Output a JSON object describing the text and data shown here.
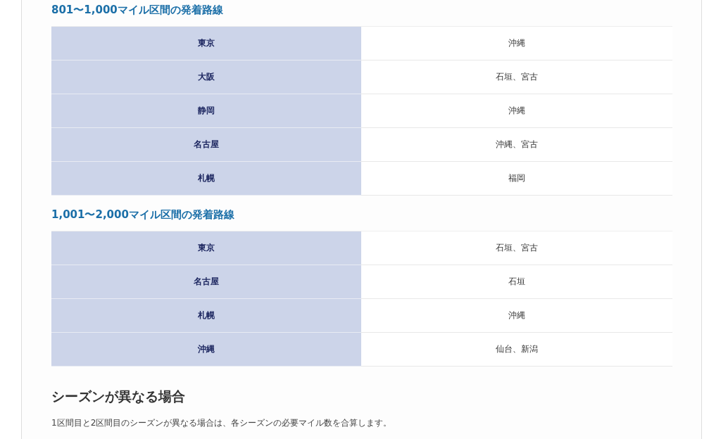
{
  "sections": [
    {
      "heading": "801〜1,000マイル区間の発着路線",
      "rows": [
        {
          "origin": "東京",
          "destinations": "沖縄"
        },
        {
          "origin": "大阪",
          "destinations": "石垣、宮古"
        },
        {
          "origin": "静岡",
          "destinations": "沖縄"
        },
        {
          "origin": "名古屋",
          "destinations": "沖縄、宮古"
        },
        {
          "origin": "札幌",
          "destinations": "福岡"
        }
      ]
    },
    {
      "heading": "1,001〜2,000マイル区間の発着路線",
      "rows": [
        {
          "origin": "東京",
          "destinations": "石垣、宮古"
        },
        {
          "origin": "名古屋",
          "destinations": "石垣"
        },
        {
          "origin": "札幌",
          "destinations": "沖縄"
        },
        {
          "origin": "沖縄",
          "destinations": "仙台、新潟"
        }
      ]
    }
  ],
  "season": {
    "heading": "シーズンが異なる場合",
    "text": "1区間目と2区間目のシーズンが異なる場合は、各シーズンの必要マイル数を合算します。"
  }
}
